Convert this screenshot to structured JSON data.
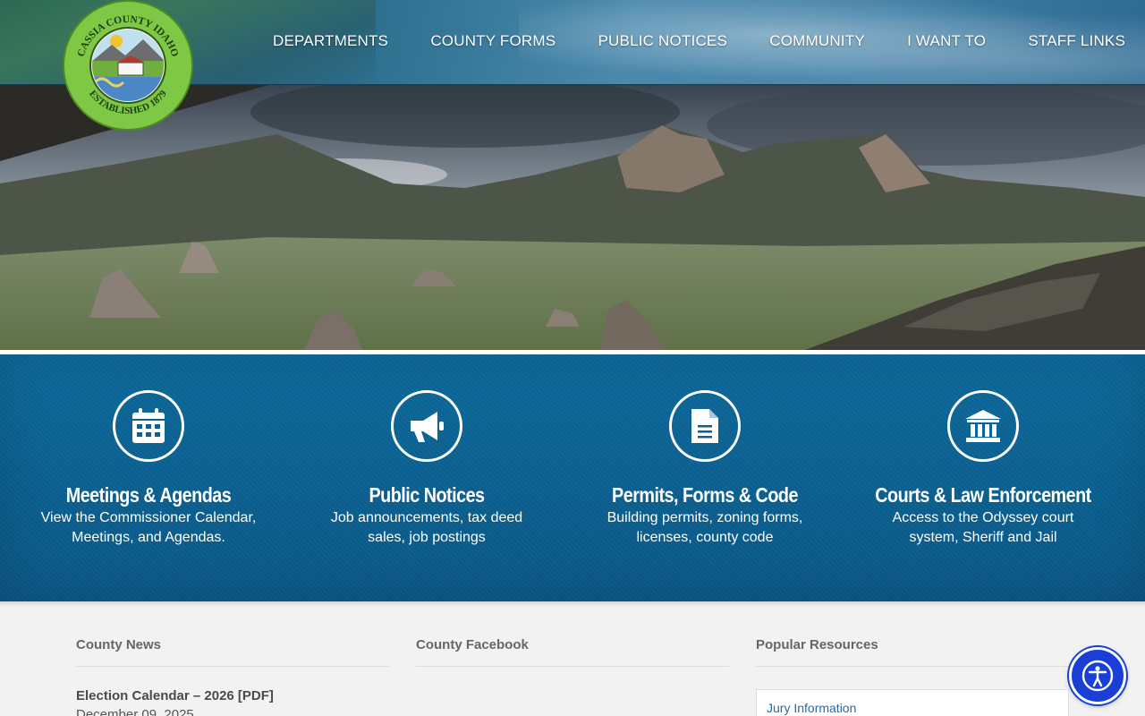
{
  "header": {
    "seal": {
      "top_text": "CASSIA COUNTY IDAHO",
      "bottom_text": "ESTABLISHED 1879"
    },
    "nav": [
      {
        "label": "DEPARTMENTS"
      },
      {
        "label": "COUNTY FORMS"
      },
      {
        "label": "PUBLIC NOTICES"
      },
      {
        "label": "COMMUNITY"
      },
      {
        "label": "I WANT TO"
      },
      {
        "label": "STAFF LINKS"
      }
    ]
  },
  "quick_links": [
    {
      "icon": "calendar-icon",
      "title": "Meetings & Agendas",
      "desc": "View the Commissioner Calendar, Meetings, and Agendas."
    },
    {
      "icon": "megaphone-icon",
      "title": "Public Notices",
      "desc": "Job announcements, tax deed sales, job postings"
    },
    {
      "icon": "document-icon",
      "title": "Permits, Forms & Code",
      "desc": "Building permits, zoning forms, licenses, county code"
    },
    {
      "icon": "courthouse-icon",
      "title": "Courts & Law Enforcement",
      "desc": "Access to the Odyssey court system, Sheriff and Jail"
    }
  ],
  "sections": {
    "news": {
      "heading": "County News",
      "items": [
        {
          "title": "Election Calendar – 2026 [PDF]",
          "date": "December 09, 2025"
        }
      ]
    },
    "facebook": {
      "heading": "County Facebook"
    },
    "resources": {
      "heading": "Popular Resources",
      "items": [
        {
          "label": "Jury Information"
        }
      ]
    }
  },
  "colors": {
    "band": "#0a5f8f",
    "accessibility_button": "#1a3fd6"
  }
}
